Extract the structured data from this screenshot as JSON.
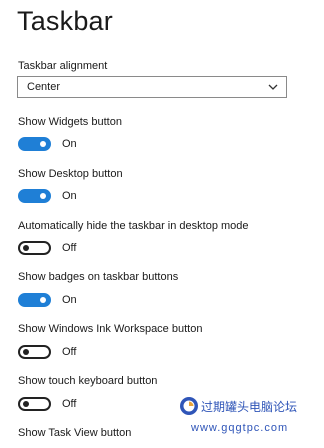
{
  "title": "Taskbar",
  "alignment": {
    "label": "Taskbar alignment",
    "value": "Center"
  },
  "settings": [
    {
      "label": "Show Widgets button",
      "state": "On"
    },
    {
      "label": "Show Desktop button",
      "state": "On"
    },
    {
      "label": "Automatically hide the taskbar in desktop mode",
      "state": "Off"
    },
    {
      "label": "Show badges on taskbar buttons",
      "state": "On"
    },
    {
      "label": "Show Windows Ink Workspace button",
      "state": "Off"
    },
    {
      "label": "Show touch keyboard button",
      "state": "Off"
    },
    {
      "label": "Show Task View button"
    }
  ],
  "watermark": {
    "text": "过期罐头电脑论坛",
    "url": "www.gqgtpc.com"
  },
  "colors": {
    "accent": "#1f7fd6",
    "toggle_off_border": "#222222",
    "watermark": "#2f55b8"
  },
  "icons": {
    "dropdown": "chevron-down-icon",
    "watermark_logo": "forum-logo-icon"
  }
}
